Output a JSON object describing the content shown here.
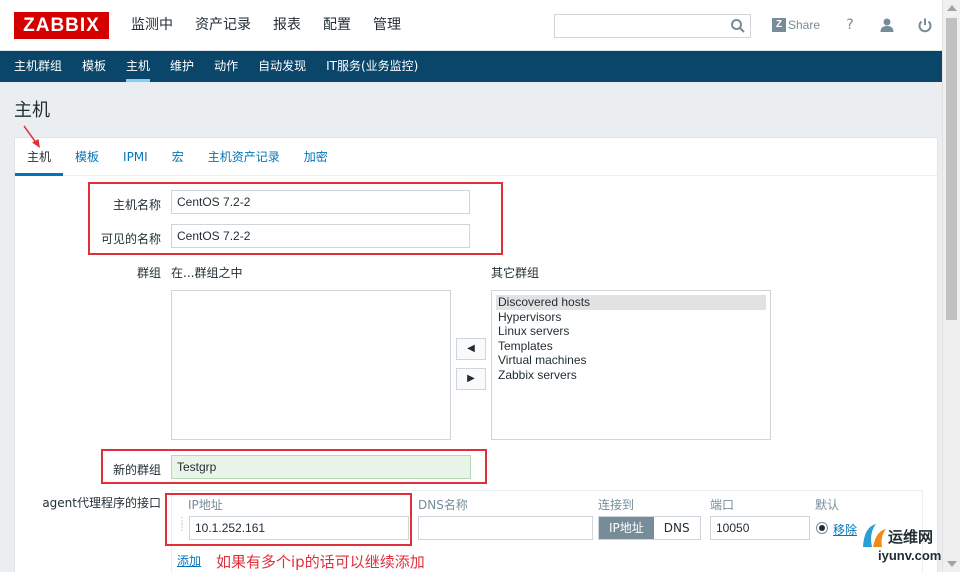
{
  "header": {
    "logo": "ZABBIX",
    "menu": [
      "监测中",
      "资产记录",
      "报表",
      "配置",
      "管理"
    ],
    "search": {
      "value": "",
      "placeholder": ""
    },
    "share_label": "Share",
    "help_label": "?"
  },
  "subnav": {
    "items": [
      "主机群组",
      "模板",
      "主机",
      "维护",
      "动作",
      "自动发现",
      "IT服务(业务监控)"
    ],
    "active": "主机"
  },
  "page_title": "主机",
  "tabs": [
    "主机",
    "模板",
    "IPMI",
    "宏",
    "主机资产记录",
    "加密"
  ],
  "form": {
    "host_name_label": "主机名称",
    "host_name_value": "CentOS 7.2-2",
    "visible_name_label": "可见的名称",
    "visible_name_value": "CentOS 7.2-2",
    "groups_label": "群组",
    "in_groups_label": "在...群组之中",
    "other_groups_label": "其它群组",
    "in_groups": [],
    "other_groups": [
      "Discovered hosts",
      "Hypervisors",
      "Linux servers",
      "Templates",
      "Virtual machines",
      "Zabbix servers"
    ],
    "selected_other_group": "Discovered hosts",
    "move_left": "◀",
    "move_right": "▶",
    "new_group_label": "新的群组",
    "new_group_value": "Testgrp",
    "agent_label": "agent代理程序的接口",
    "interface_headers": {
      "ip": "IP地址",
      "dns": "DNS名称",
      "connect": "连接到",
      "port": "端口",
      "default": "默认"
    },
    "ip_value": "10.1.252.161",
    "dns_value": "",
    "connect_options": [
      "IP地址",
      "DNS"
    ],
    "port_value": "10050",
    "remove_label": "移除",
    "add_label": "添加"
  },
  "annotation": "如果有多个ip的话可以继续添加",
  "watermark": {
    "title": "运维网",
    "url": "iyunv.com"
  }
}
